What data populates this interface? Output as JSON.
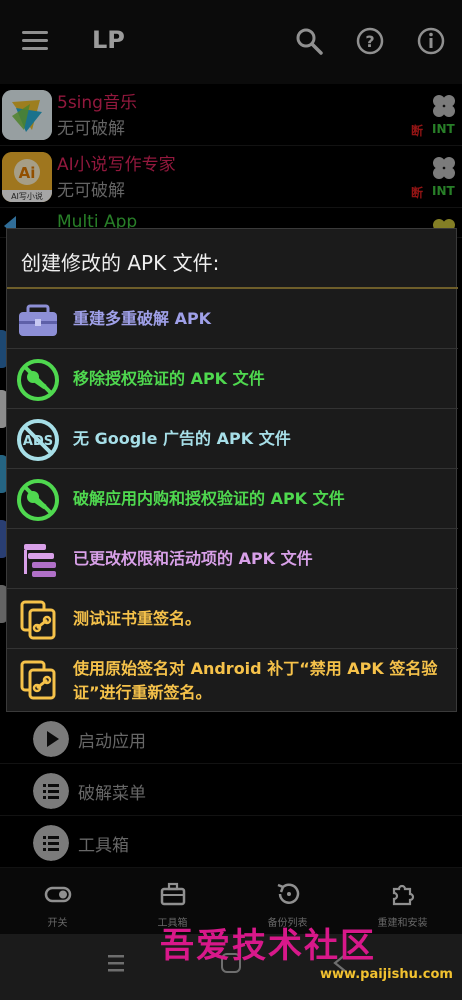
{
  "appbar": {
    "title": "LP"
  },
  "apps": [
    {
      "name": "5sing音乐",
      "status": "无可破解",
      "tag_left": "断",
      "tag_right": "INT"
    },
    {
      "name": "AI小说写作专家",
      "status": "无可破解",
      "tag_left": "断",
      "tag_right": "INT",
      "icon_caption": "AI写小说"
    },
    {
      "name": "Multi App"
    }
  ],
  "dialog": {
    "title": "创建修改的 APK 文件:",
    "options": [
      {
        "label": "重建多重破解 APK",
        "icon": "toolbox-icon",
        "color": "#9fa0e8"
      },
      {
        "label": "移除授权验证的 APK 文件",
        "icon": "no-license-icon",
        "color": "#4fd84f"
      },
      {
        "label": "无 Google 广告的 APK 文件",
        "icon": "no-ads-icon",
        "color": "#a7dfe8"
      },
      {
        "label": "破解应用内购和授权验证的 APK 文件",
        "icon": "no-license-icon",
        "color": "#4fd84f"
      },
      {
        "label": "已更改权限和活动项的 APK 文件",
        "icon": "permissions-list-icon",
        "color": "#d8a0e8"
      },
      {
        "label": "测试证书重签名。",
        "icon": "resign-icon",
        "color": "#f6c24a"
      },
      {
        "label": "使用原始签名对 Android 补丁“禁用 APK 签名验证”进行重新签名。",
        "icon": "resign-icon",
        "color": "#f6c24a"
      }
    ]
  },
  "menu": [
    {
      "label": "启动应用",
      "icon": "play-icon"
    },
    {
      "label": "破解菜单",
      "icon": "list-icon"
    },
    {
      "label": "工具箱",
      "icon": "list-icon"
    }
  ],
  "bottomnav": [
    {
      "label": "开关",
      "icon": "toggle-icon"
    },
    {
      "label": "工具箱",
      "icon": "toolbox-icon"
    },
    {
      "label": "备份列表",
      "icon": "restore-icon"
    },
    {
      "label": "重建和安装",
      "icon": "puzzle-icon"
    }
  ],
  "watermark": {
    "title": "吾爱技术社区",
    "url": "www.paijishu.com"
  },
  "colors": {
    "app_name_red": "#e0265e",
    "app_name_green": "#3ec43e",
    "dialog_divider": "#6e5e2a"
  }
}
